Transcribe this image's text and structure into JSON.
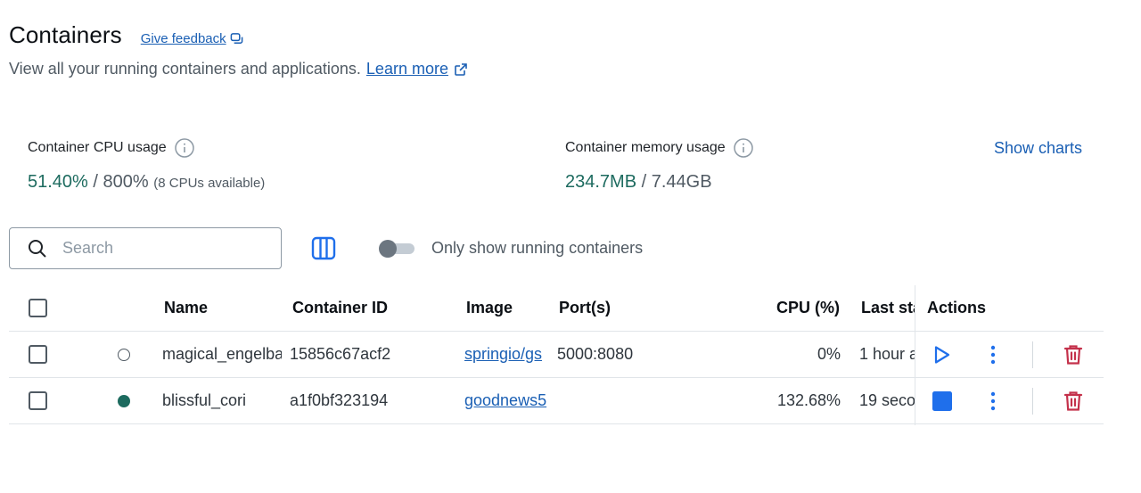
{
  "header": {
    "title": "Containers",
    "feedback_label": "Give feedback",
    "subtitle": "View all your running containers and applications.",
    "learn_more": "Learn more"
  },
  "stats": {
    "cpu": {
      "label": "Container CPU usage",
      "used": "51.40%",
      "separator": " / ",
      "total": "800%",
      "available": "(8 CPUs available)"
    },
    "memory": {
      "label": "Container memory usage",
      "used": "234.7MB",
      "separator": " / ",
      "total": "7.44GB"
    },
    "show_charts": "Show charts"
  },
  "toolbar": {
    "search_placeholder": "Search",
    "toggle_label": "Only show running containers",
    "toggle_on": false
  },
  "table": {
    "columns": {
      "name": "Name",
      "container_id": "Container ID",
      "image": "Image",
      "ports": "Port(s)",
      "cpu": "CPU (%)",
      "last_started": "Last sta",
      "actions": "Actions"
    },
    "rows": [
      {
        "status": "stopped",
        "name": "magical_engelba",
        "container_id": "15856c67acf2",
        "image": "springio/gs",
        "ports": "5000:8080",
        "cpu": "0%",
        "last_started": "1 hour a",
        "primary_action_icon": "play-icon"
      },
      {
        "status": "running",
        "name": "blissful_cori",
        "container_id": "a1f0bf323194",
        "image": "goodnews5",
        "ports": "",
        "cpu": "132.68%",
        "last_started": "19 seco",
        "primary_action_icon": "stop-icon"
      }
    ]
  },
  "colors": {
    "accent": "#1a5fb4",
    "running": "#1d6b5f",
    "delete": "#c4314b",
    "stop": "#1f6feb"
  }
}
